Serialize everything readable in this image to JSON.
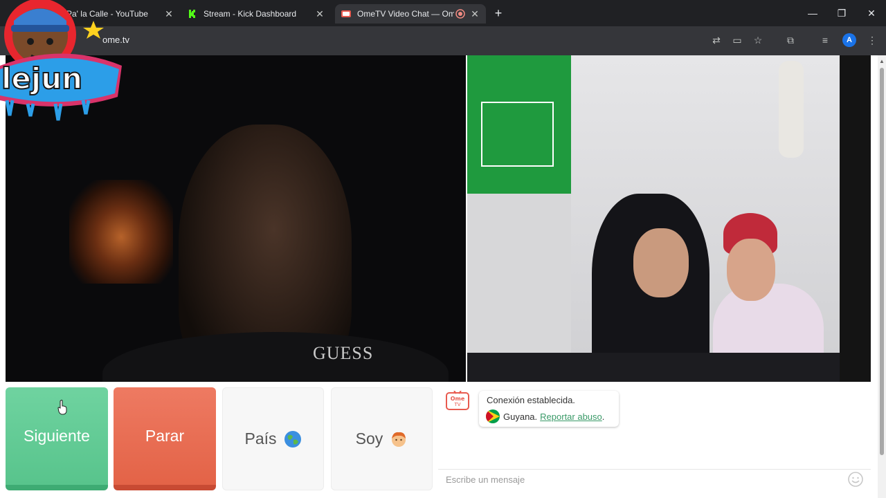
{
  "browser": {
    "tabs": [
      {
        "title": "Pa' la Calle - YouTube",
        "favicon": "youtube-icon"
      },
      {
        "title": "Stream - Kick Dashboard",
        "favicon": "kick-icon"
      },
      {
        "title": "OmeTV Video Chat — Ome",
        "favicon": "ometv-icon",
        "active": true
      }
    ],
    "url": "ome.tv",
    "profile_initial": "A"
  },
  "overlay": {
    "logo_text": "lejun"
  },
  "video": {
    "shirt_text": "GUESS"
  },
  "controls": {
    "next_label": "Siguiente",
    "stop_label": "Parar",
    "country_label": "País",
    "gender_label": "Soy"
  },
  "chat": {
    "status": "Conexión establecida.",
    "country": "Guyana.",
    "report_link": "Reportar abuso",
    "report_suffix": ".",
    "input_placeholder": "Escribe un mensaje",
    "ome_logo_text_1": "Ome",
    "ome_logo_text_2": "TV"
  },
  "colors": {
    "next": "#5fca93",
    "stop": "#e76b51",
    "link": "#3a9a68"
  }
}
